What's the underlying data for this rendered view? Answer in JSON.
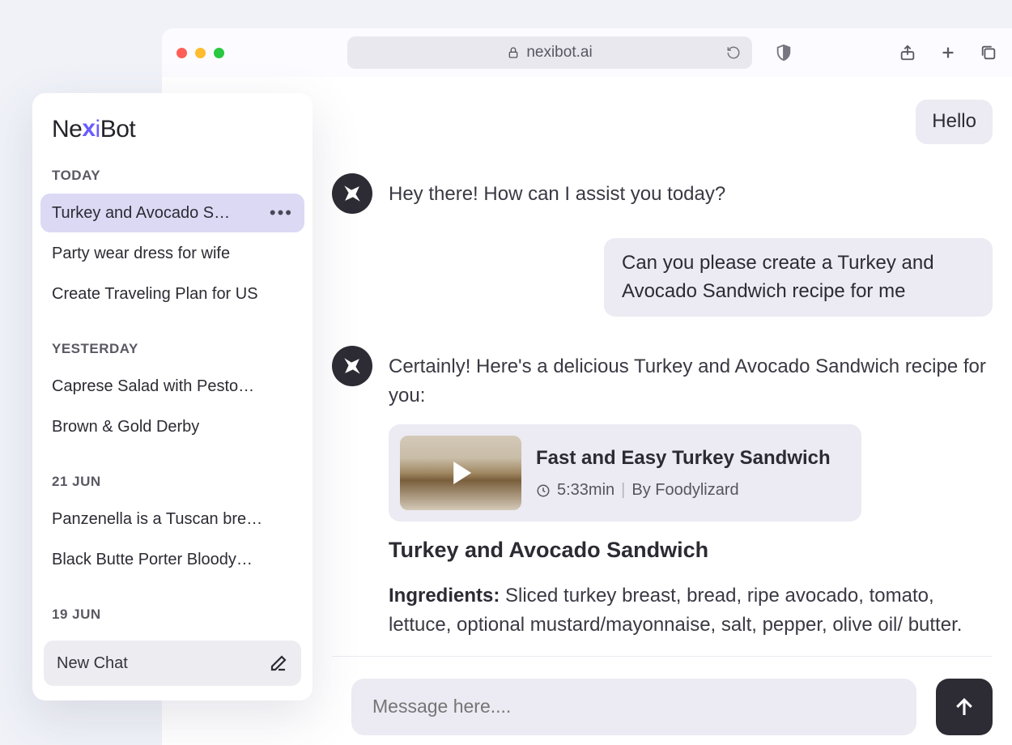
{
  "browser": {
    "url": "nexibot.ai"
  },
  "logo": {
    "part1": "Ne",
    "x": "x",
    "i": "i",
    "rest": "Bot"
  },
  "sidebar": {
    "sections": [
      {
        "label": "TODAY",
        "items": [
          {
            "title": "Turkey and Avocado S…",
            "active": true
          },
          {
            "title": "Party wear dress for wife"
          },
          {
            "title": "Create Traveling Plan for US"
          }
        ]
      },
      {
        "label": "YESTERDAY",
        "items": [
          {
            "title": "Caprese Salad with Pesto…"
          },
          {
            "title": "Brown & Gold Derby"
          }
        ]
      },
      {
        "label": "21 JUN",
        "items": [
          {
            "title": "Panzenella is a Tuscan bre…"
          },
          {
            "title": "Black Butte Porter Bloody…"
          }
        ]
      },
      {
        "label": "19 JUN",
        "items": []
      }
    ],
    "new_chat_label": "New Chat"
  },
  "chat": {
    "user1": "Hello",
    "bot1": "Hey there! How can I assist you today?",
    "user2": "Can you please create a Turkey and Avocado Sandwich recipe for me",
    "bot2_intro": "Certainly! Here's a delicious Turkey and Avocado Sandwich recipe for you:",
    "video": {
      "title": "Fast and Easy Turkey Sandwich",
      "duration": "5:33min",
      "author": "By Foodylizard"
    },
    "recipe_title": "Turkey and Avocado Sandwich",
    "ingredients_label": "Ingredients:",
    "ingredients_text": " Sliced turkey breast, bread, ripe avocado, tomato, lettuce, optional mustard/mayonnaise, salt, pepper, olive oil/ butter."
  },
  "composer": {
    "placeholder": "Message here...."
  }
}
